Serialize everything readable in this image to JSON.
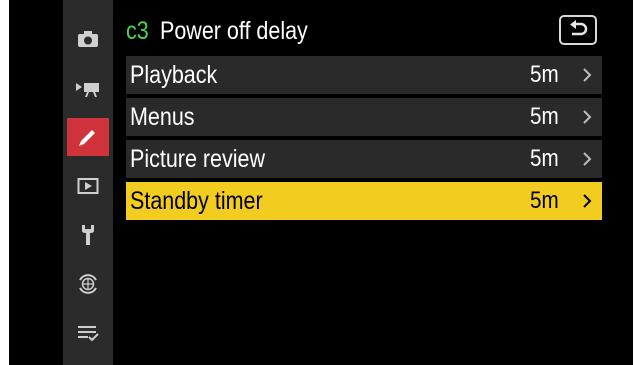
{
  "header": {
    "code": "c3",
    "title": "Power off delay",
    "back_icon": "return-arrow-icon"
  },
  "sidebar": {
    "items": [
      {
        "name": "photo-shooting-menu",
        "icon": "camera-icon",
        "active": false
      },
      {
        "name": "video-recording-menu",
        "icon": "movie-camera-icon",
        "active": false
      },
      {
        "name": "custom-settings-menu",
        "icon": "pencil-icon",
        "active": true
      },
      {
        "name": "playback-menu",
        "icon": "playback-icon",
        "active": false
      },
      {
        "name": "setup-menu",
        "icon": "wrench-icon",
        "active": false
      },
      {
        "name": "network-menu",
        "icon": "network-globe-icon",
        "active": false
      },
      {
        "name": "my-menu",
        "icon": "my-menu-checklist-icon",
        "active": false
      }
    ]
  },
  "rows": [
    {
      "label": "Playback",
      "value": "5m",
      "selected": false
    },
    {
      "label": "Menus",
      "value": "5m",
      "selected": false
    },
    {
      "label": "Picture review",
      "value": "5m",
      "selected": false
    },
    {
      "label": "Standby timer",
      "value": "5m",
      "selected": true
    }
  ],
  "colors": {
    "accent_code": "#49d64e",
    "selected_row": "#f2cc1e",
    "active_tab": "#d0333b",
    "row_bg": "#2a2a2a",
    "sidebar_bg": "#2b2b2b"
  }
}
